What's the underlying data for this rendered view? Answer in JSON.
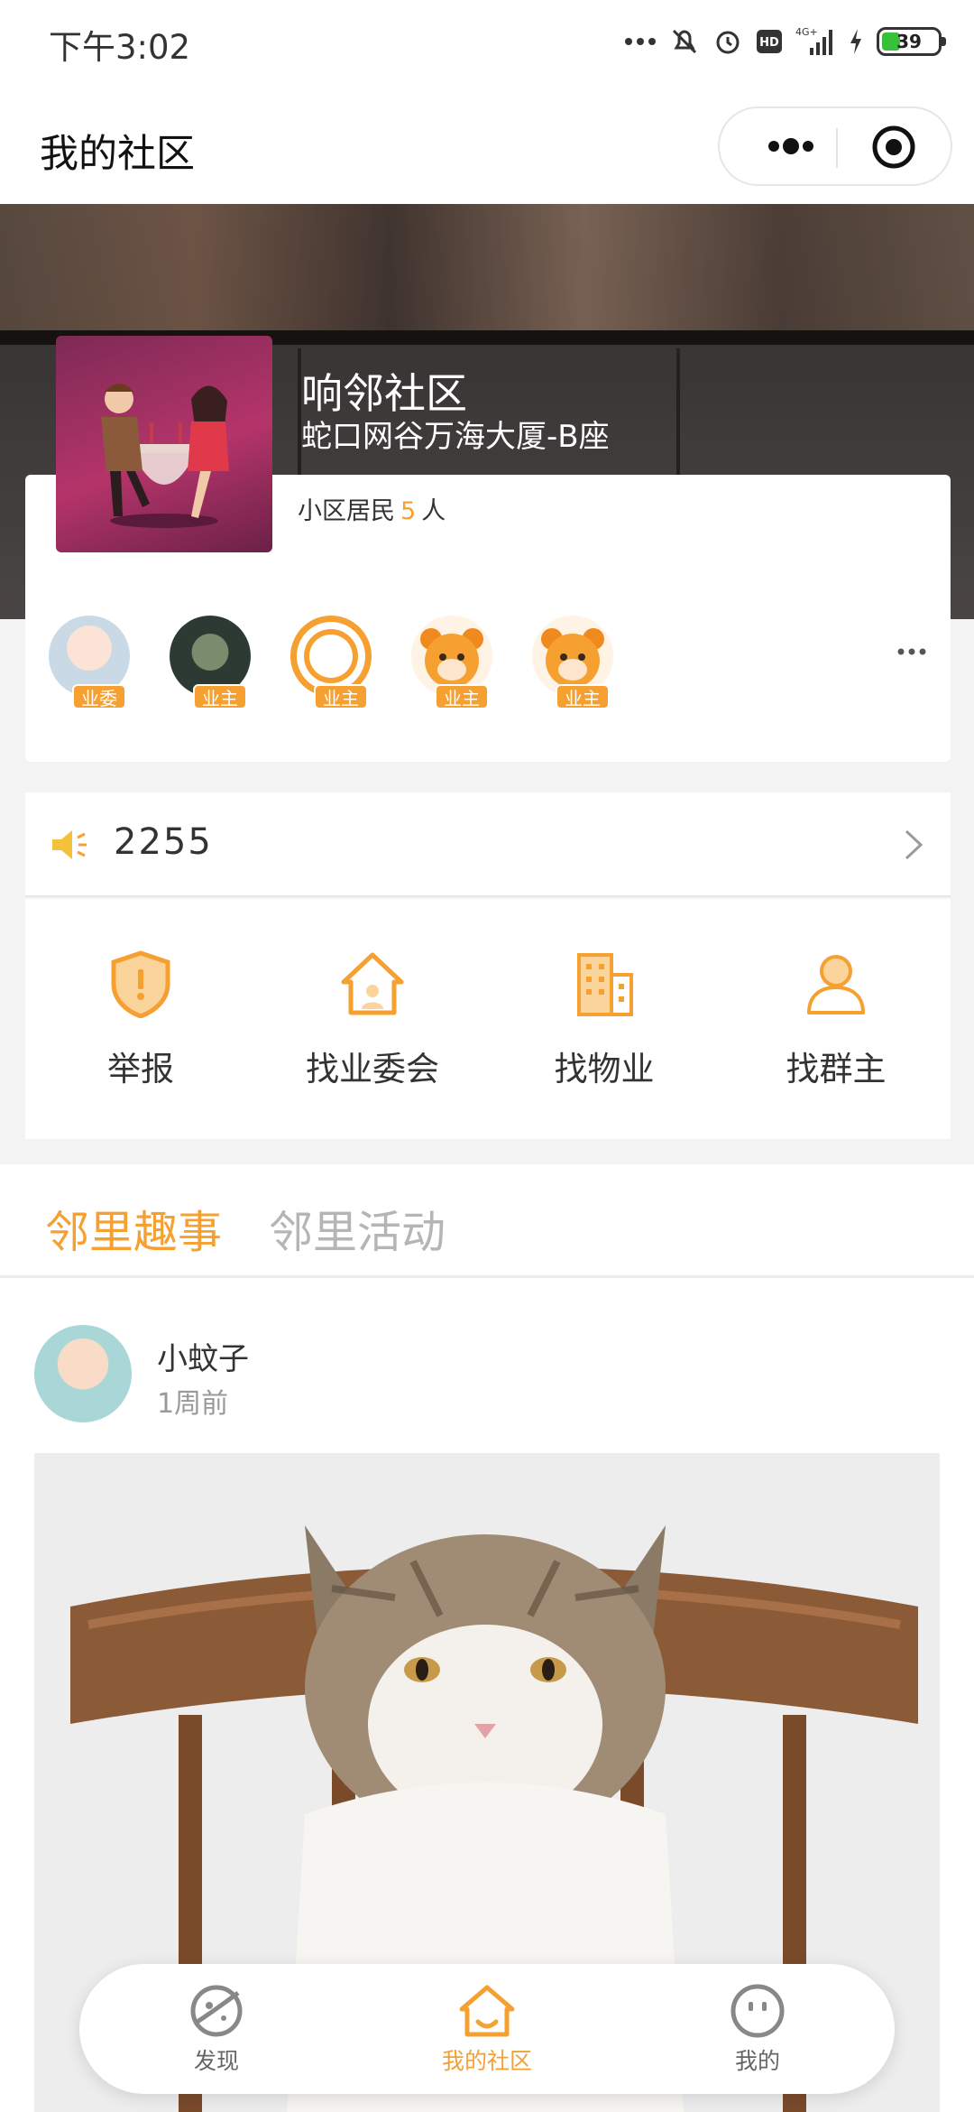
{
  "status_bar": {
    "time": "下午3:02",
    "battery": "39",
    "network": "4G+",
    "hd": "HD"
  },
  "navbar": {
    "title": "我的社区",
    "more_icon": "more-dots-icon",
    "close_icon": "target-icon"
  },
  "community": {
    "name": "响邻社区",
    "address": "蛇口网谷万海大厦-B座",
    "residents_prefix": "小区居民",
    "residents_count": "5",
    "residents_suffix": "人",
    "members": [
      {
        "role": "业委"
      },
      {
        "role": "业主"
      },
      {
        "role": "业主"
      },
      {
        "role": "业主"
      },
      {
        "role": "业主"
      }
    ]
  },
  "notice": {
    "value": "2255",
    "icon": "speaker-icon"
  },
  "services": [
    {
      "label": "举报",
      "icon": "shield-icon"
    },
    {
      "label": "找业委会",
      "icon": "house-icon"
    },
    {
      "label": "找物业",
      "icon": "building-icon"
    },
    {
      "label": "找群主",
      "icon": "person-icon"
    }
  ],
  "feed": {
    "tabs": [
      "邻里趣事",
      "邻里活动"
    ],
    "post": {
      "author": "小蚊子",
      "time": "1周前"
    }
  },
  "tabbar": [
    {
      "label": "发现",
      "icon": "planet-icon"
    },
    {
      "label": "我的社区",
      "icon": "home-icon"
    },
    {
      "label": "我的",
      "icon": "face-icon"
    }
  ],
  "colors": {
    "accent": "#f5a031",
    "text": "#333333",
    "muted": "#999999"
  }
}
